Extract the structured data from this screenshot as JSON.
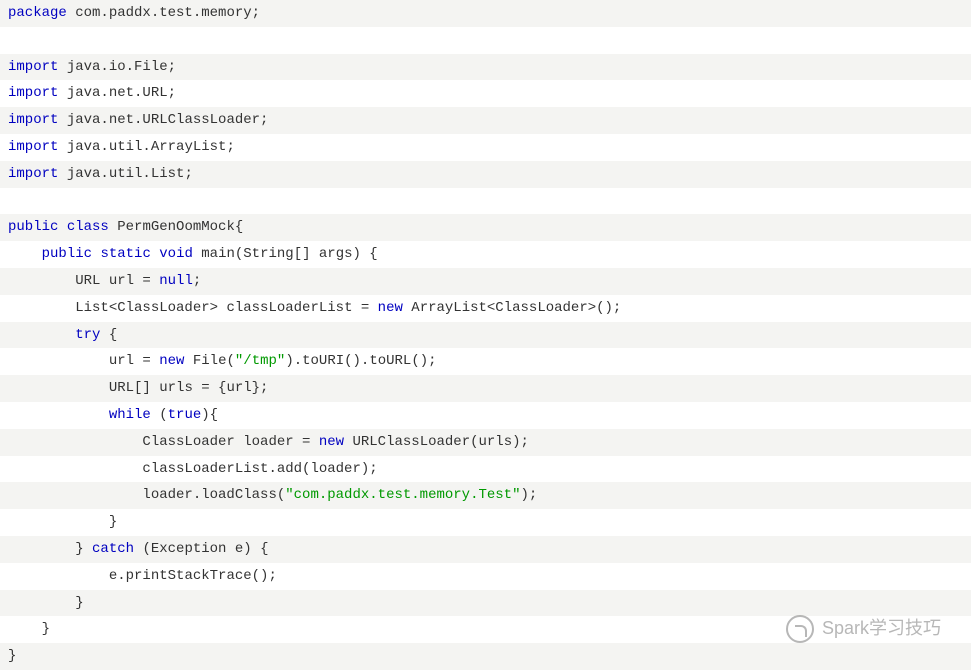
{
  "code": {
    "lines": [
      {
        "indent": 0,
        "tokens": [
          [
            "kw",
            "package"
          ],
          [
            "txt",
            " com.paddx.test.memory;"
          ]
        ]
      },
      {
        "indent": 0,
        "tokens": [
          [
            "txt",
            " "
          ]
        ]
      },
      {
        "indent": 0,
        "tokens": [
          [
            "kw",
            "import"
          ],
          [
            "txt",
            " java.io.File;"
          ]
        ]
      },
      {
        "indent": 0,
        "tokens": [
          [
            "kw",
            "import"
          ],
          [
            "txt",
            " java.net.URL;"
          ]
        ]
      },
      {
        "indent": 0,
        "tokens": [
          [
            "kw",
            "import"
          ],
          [
            "txt",
            " java.net.URLClassLoader;"
          ]
        ]
      },
      {
        "indent": 0,
        "tokens": [
          [
            "kw",
            "import"
          ],
          [
            "txt",
            " java.util.ArrayList;"
          ]
        ]
      },
      {
        "indent": 0,
        "tokens": [
          [
            "kw",
            "import"
          ],
          [
            "txt",
            " java.util.List;"
          ]
        ]
      },
      {
        "indent": 0,
        "tokens": [
          [
            "txt",
            " "
          ]
        ]
      },
      {
        "indent": 0,
        "tokens": [
          [
            "kw",
            "public"
          ],
          [
            "txt",
            " "
          ],
          [
            "kw",
            "class"
          ],
          [
            "txt",
            " PermGenOomMock{"
          ]
        ]
      },
      {
        "indent": 1,
        "tokens": [
          [
            "kw",
            "public"
          ],
          [
            "txt",
            " "
          ],
          [
            "kw",
            "static"
          ],
          [
            "txt",
            " "
          ],
          [
            "kw",
            "void"
          ],
          [
            "txt",
            " main(String[] args) {"
          ]
        ]
      },
      {
        "indent": 2,
        "tokens": [
          [
            "txt",
            "URL url = "
          ],
          [
            "kw",
            "null"
          ],
          [
            "txt",
            ";"
          ]
        ]
      },
      {
        "indent": 2,
        "tokens": [
          [
            "txt",
            "List<ClassLoader> classLoaderList = "
          ],
          [
            "kw",
            "new"
          ],
          [
            "txt",
            " ArrayList<ClassLoader>();"
          ]
        ]
      },
      {
        "indent": 2,
        "tokens": [
          [
            "kw",
            "try"
          ],
          [
            "txt",
            " {"
          ]
        ]
      },
      {
        "indent": 3,
        "tokens": [
          [
            "txt",
            "url = "
          ],
          [
            "kw",
            "new"
          ],
          [
            "txt",
            " File("
          ],
          [
            "str",
            "\"/tmp\""
          ],
          [
            "txt",
            ").toURI().toURL();"
          ]
        ]
      },
      {
        "indent": 3,
        "tokens": [
          [
            "txt",
            "URL[] urls = {url};"
          ]
        ]
      },
      {
        "indent": 3,
        "tokens": [
          [
            "kw",
            "while"
          ],
          [
            "txt",
            " ("
          ],
          [
            "kw",
            "true"
          ],
          [
            "txt",
            "){"
          ]
        ]
      },
      {
        "indent": 4,
        "tokens": [
          [
            "txt",
            "ClassLoader loader = "
          ],
          [
            "kw",
            "new"
          ],
          [
            "txt",
            " URLClassLoader(urls);"
          ]
        ]
      },
      {
        "indent": 4,
        "tokens": [
          [
            "txt",
            "classLoaderList.add(loader);"
          ]
        ]
      },
      {
        "indent": 4,
        "tokens": [
          [
            "txt",
            "loader.loadClass("
          ],
          [
            "str",
            "\"com.paddx.test.memory.Test\""
          ],
          [
            "txt",
            ");"
          ]
        ]
      },
      {
        "indent": 3,
        "tokens": [
          [
            "txt",
            "}"
          ]
        ]
      },
      {
        "indent": 2,
        "tokens": [
          [
            "txt",
            "} "
          ],
          [
            "kw",
            "catch"
          ],
          [
            "txt",
            " (Exception e) {"
          ]
        ]
      },
      {
        "indent": 3,
        "tokens": [
          [
            "txt",
            "e.printStackTrace();"
          ]
        ]
      },
      {
        "indent": 2,
        "tokens": [
          [
            "txt",
            "}"
          ]
        ]
      },
      {
        "indent": 1,
        "tokens": [
          [
            "txt",
            "}"
          ]
        ]
      },
      {
        "indent": 0,
        "tokens": [
          [
            "txt",
            "}"
          ]
        ]
      }
    ]
  },
  "watermark": {
    "text": "Spark学习技巧"
  }
}
